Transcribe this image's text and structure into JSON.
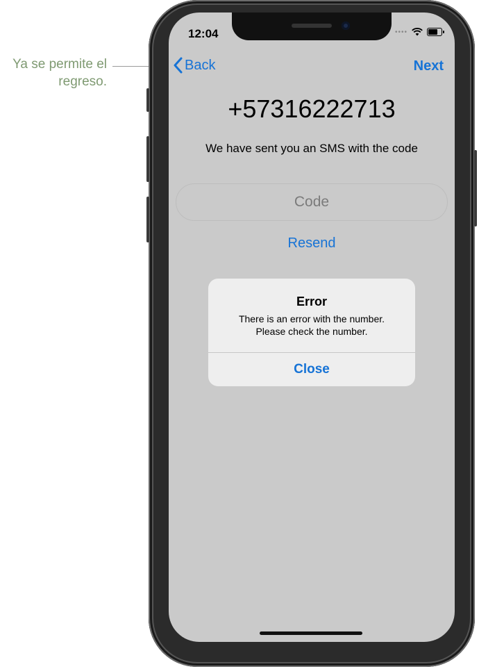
{
  "annotation": {
    "text": "Ya se permite el regreso."
  },
  "status_bar": {
    "time": "12:04"
  },
  "nav": {
    "back_label": "Back",
    "next_label": "Next"
  },
  "content": {
    "phone_number": "+57316222713",
    "sms_message": "We have sent you an SMS with the code",
    "code_placeholder": "Code",
    "resend_label": "Resend"
  },
  "alert": {
    "title": "Error",
    "message_line1": "There is an error with the number.",
    "message_line2": "Please check the number.",
    "close_label": "Close"
  },
  "colors": {
    "accent": "#1673d6",
    "screen_bg": "#cacaca",
    "annotation": "#7f9a72"
  }
}
